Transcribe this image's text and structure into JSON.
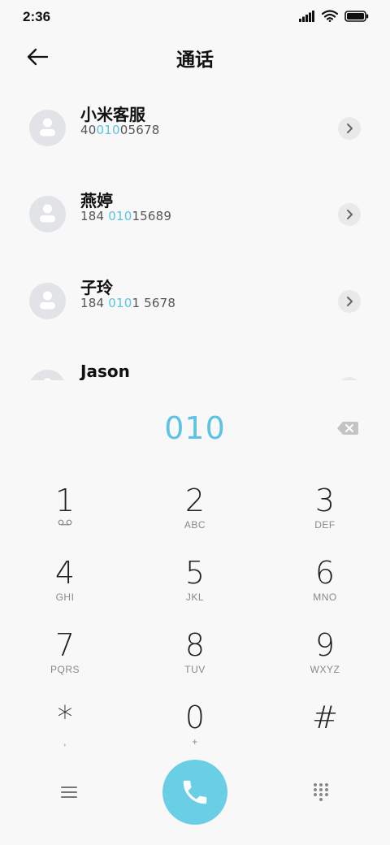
{
  "status_bar": {
    "time": "2:36",
    "icons": [
      "signal-icon",
      "wifi-icon",
      "battery-icon"
    ]
  },
  "header": {
    "title": "通话",
    "back_icon": "back-arrow-icon"
  },
  "contacts": [
    {
      "name": "小米客服",
      "number_pre": "40",
      "number_match": "010",
      "number_post": "05678"
    },
    {
      "name": "燕婷",
      "number_pre": "184 ",
      "number_match": "010",
      "number_post": "15689"
    },
    {
      "name": "子玲",
      "number_pre": "184 ",
      "number_match": "010",
      "number_post": "1 5678"
    },
    {
      "name": "Jason",
      "number_pre": "",
      "number_match": "",
      "number_post": ""
    }
  ],
  "dialer": {
    "entered_number": "010",
    "backspace_icon": "backspace-icon"
  },
  "keypad": [
    {
      "digit": "1",
      "letters": "",
      "sub_icon": "voicemail-icon"
    },
    {
      "digit": "2",
      "letters": "ABC"
    },
    {
      "digit": "3",
      "letters": "DEF"
    },
    {
      "digit": "4",
      "letters": "GHI"
    },
    {
      "digit": "5",
      "letters": "JKL"
    },
    {
      "digit": "6",
      "letters": "MNO"
    },
    {
      "digit": "7",
      "letters": "PQRS"
    },
    {
      "digit": "8",
      "letters": "TUV"
    },
    {
      "digit": "9",
      "letters": "WXYZ"
    },
    {
      "digit": "*",
      "letters": ","
    },
    {
      "digit": "0",
      "letters": "+"
    },
    {
      "digit": "#",
      "letters": ""
    }
  ],
  "bottom_bar": {
    "menu_icon": "menu-icon",
    "call_icon": "phone-icon",
    "keypad_icon": "dialpad-icon"
  },
  "colors": {
    "accent": "#5cc3e4",
    "call_button": "#6acfe5",
    "background": "#f8f8f8",
    "avatar": "#e1e3e7"
  }
}
